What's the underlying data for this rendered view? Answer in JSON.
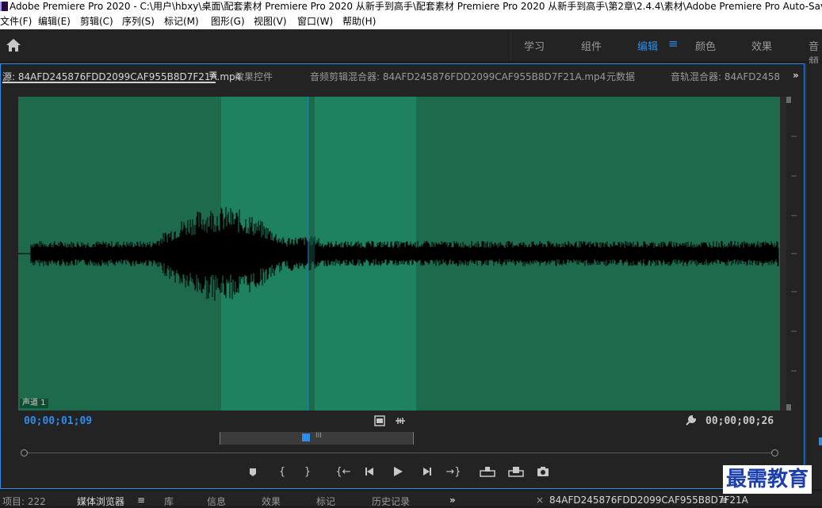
{
  "window": {
    "title": "Adobe Premiere Pro 2020 - C:\\用户\\hbxy\\桌面\\配套素材 Premiere Pro 2020 从新手到高手\\配套素材 Premiere Pro 2020 从新手到高手\\第2章\\2.4.4\\素材\\Adobe Premiere Pro Auto-Save"
  },
  "menu": [
    "文件(F)",
    "编辑(E)",
    "剪辑(C)",
    "序列(S)",
    "标记(M)",
    "图形(G)",
    "视图(V)",
    "窗口(W)",
    "帮助(H)"
  ],
  "workspaces": [
    {
      "label": "学习",
      "active": false
    },
    {
      "label": "组件",
      "active": false
    },
    {
      "label": "编辑",
      "active": true
    },
    {
      "label": "颜色",
      "active": false
    },
    {
      "label": "效果",
      "active": false
    },
    {
      "label": "音频",
      "active": false
    }
  ],
  "panel_tabs": {
    "source": "源: 84AFD245876FDD2099CAF955B8D7F21A.mp4",
    "effect_controls": "效果控件",
    "audio_clip_mixer": "音频剪辑混合器: 84AFD245876FDD2099CAF955B8D7F21A.mp4",
    "metadata": "元数据",
    "audio_track_mixer": "音轨混合器: 84AFD2458"
  },
  "source_monitor": {
    "channel_label": "声道 1",
    "timecode_current": "00;00;01;09",
    "timecode_duration": "00;00;00;26",
    "zoom_marker": "III"
  },
  "bottom_tabs": {
    "project": "项目: 222",
    "media_browser": "媒体浏览器",
    "library": "库",
    "info": "信息",
    "effects": "效果",
    "markers": "标记",
    "history": "历史记录",
    "timeline": "84AFD245876FDD2099CAF955B8D7F21A"
  },
  "watermark": "最需教育",
  "colors": {
    "accent": "#2d8ceb",
    "waveform_bg": "#1e6a4c",
    "waveform_highlight": "#1e8260"
  }
}
